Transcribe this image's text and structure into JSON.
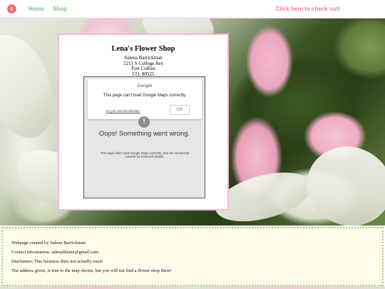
{
  "nav": {
    "home_label": "Home",
    "shop_label": "Shop",
    "checkout_label": "Click here to check out!",
    "logo_icon": "pink-flower-icon"
  },
  "shop": {
    "title": "Lena's Flower Shop",
    "owner": "Salena Barrickman",
    "street": "2211 S College Ave",
    "city": "Fort Collins",
    "state_zip": "CO, 80525"
  },
  "map": {
    "brand": "Google",
    "error_message": "This page can't load Google Maps correctly.",
    "own_site_link": "Do you own this website?",
    "ok_label": "OK",
    "oops_title": "Oops! Something went wrong.",
    "oops_detail": "This page didn't load Google Maps correctly. See the JavaScript console for technical details.",
    "warning_icon": "exclamation-icon"
  },
  "footer": {
    "created_by": "Webpage created by Salena Barrickman",
    "contact": "Contact information: salenaliliane@gmail.com",
    "disclaimer": "Disclaimer: This business does not actually exist!",
    "address_note": "The address given, is true to the map shown, but you will not find a flower shop there!"
  },
  "colors": {
    "nav_link": "#7cc17c",
    "checkout_link": "#e87aa8",
    "card_border": "#f2bcd6",
    "footer_bg": "#fefcea",
    "footer_border": "#a9c98c"
  }
}
